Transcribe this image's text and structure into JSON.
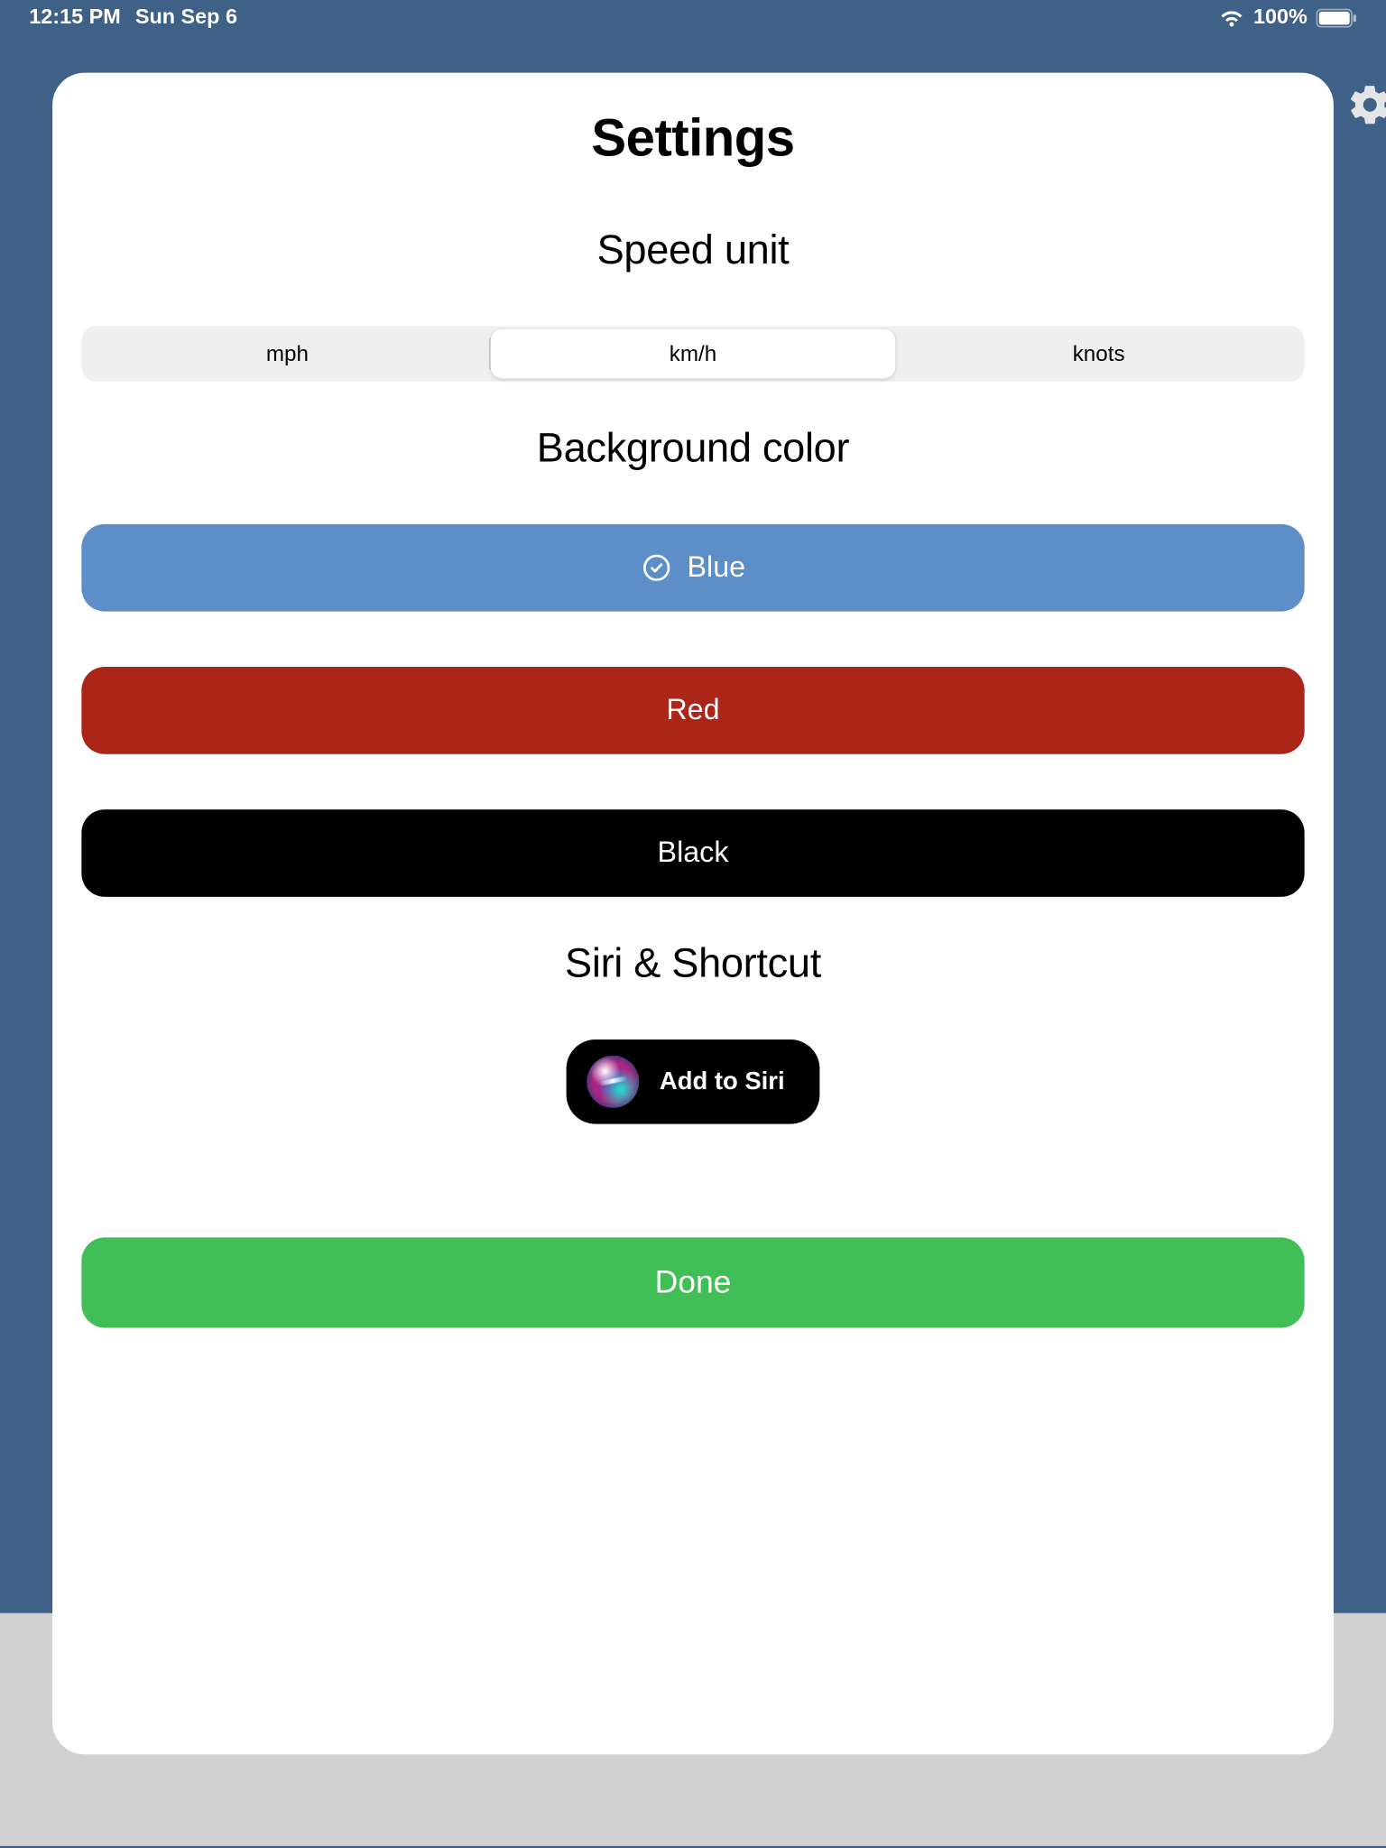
{
  "status": {
    "time": "12:15 PM",
    "date": "Sun Sep 6",
    "battery_pct": "100%"
  },
  "settings": {
    "title": "Settings",
    "speed_unit": {
      "heading": "Speed unit",
      "options": [
        "mph",
        "km/h",
        "knots"
      ],
      "selected_index": 1
    },
    "background": {
      "heading": "Background color",
      "options": [
        {
          "label": "Blue",
          "color": "#5e8ec8",
          "selected": true
        },
        {
          "label": "Red",
          "color": "#ab2518",
          "selected": false
        },
        {
          "label": "Black",
          "color": "#000000",
          "selected": false
        }
      ]
    },
    "siri": {
      "heading": "Siri & Shortcut",
      "button_label": "Add to Siri"
    },
    "done_label": "Done"
  },
  "icons": {
    "check": "check-circle",
    "wifi": "wifi",
    "battery": "battery-full",
    "gear": "gear",
    "siri": "siri-orb"
  }
}
